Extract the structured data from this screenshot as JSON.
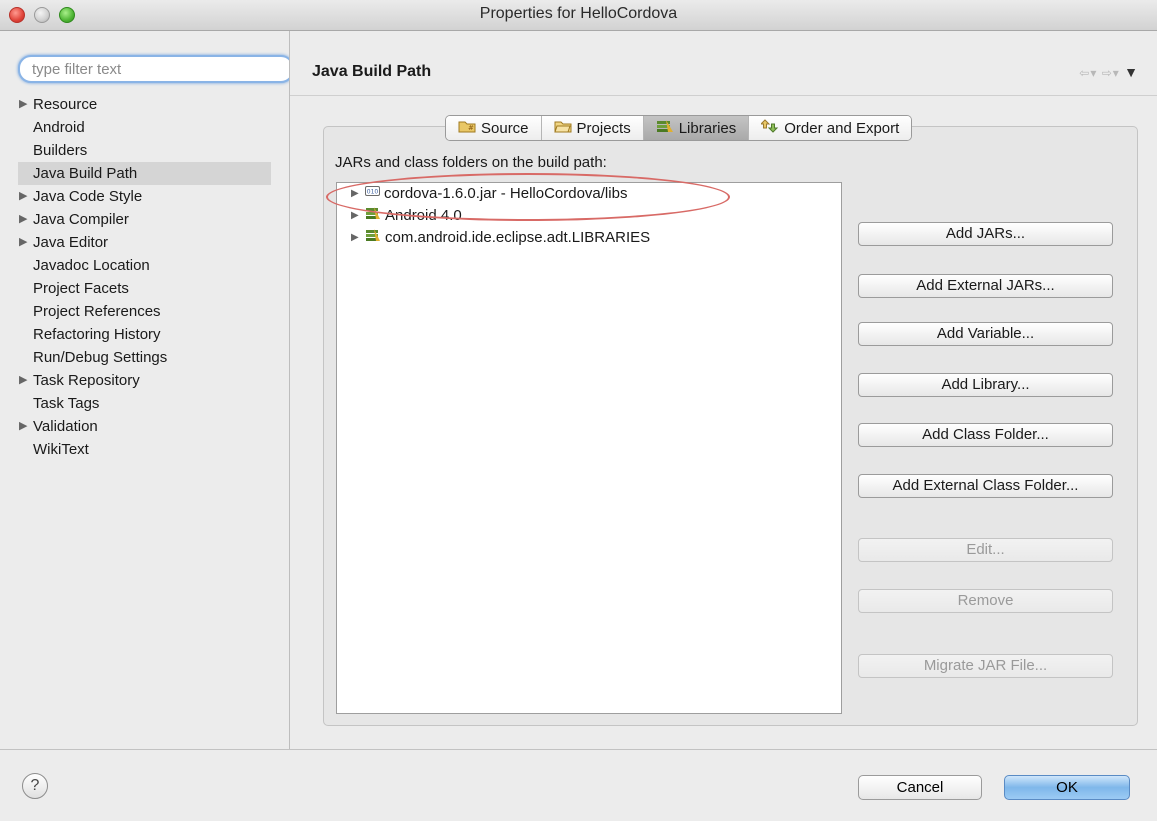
{
  "window": {
    "title": "Properties for HelloCordova"
  },
  "sidebar": {
    "filter_placeholder": "type filter text",
    "items": [
      {
        "label": "Resource",
        "expandable": true
      },
      {
        "label": "Android",
        "expandable": false
      },
      {
        "label": "Builders",
        "expandable": false
      },
      {
        "label": "Java Build Path",
        "expandable": false,
        "selected": true
      },
      {
        "label": "Java Code Style",
        "expandable": true
      },
      {
        "label": "Java Compiler",
        "expandable": true
      },
      {
        "label": "Java Editor",
        "expandable": true
      },
      {
        "label": "Javadoc Location",
        "expandable": false
      },
      {
        "label": "Project Facets",
        "expandable": false
      },
      {
        "label": "Project References",
        "expandable": false
      },
      {
        "label": "Refactoring History",
        "expandable": false
      },
      {
        "label": "Run/Debug Settings",
        "expandable": false
      },
      {
        "label": "Task Repository",
        "expandable": true
      },
      {
        "label": "Task Tags",
        "expandable": false
      },
      {
        "label": "Validation",
        "expandable": true
      },
      {
        "label": "WikiText",
        "expandable": false
      }
    ]
  },
  "main": {
    "title": "Java Build Path",
    "tabs": [
      {
        "label": "Source",
        "icon": "source-folder-icon"
      },
      {
        "label": "Projects",
        "icon": "projects-folder-icon"
      },
      {
        "label": "Libraries",
        "icon": "libraries-icon",
        "active": true
      },
      {
        "label": "Order and Export",
        "icon": "order-export-icon"
      }
    ],
    "build_path_label": "JARs and class folders on the build path:",
    "libraries": [
      {
        "label": "cordova-1.6.0.jar - HelloCordova/libs",
        "icon": "jar-icon"
      },
      {
        "label": "Android 4.0",
        "icon": "library-container-icon"
      },
      {
        "label": "com.android.ide.eclipse.adt.LIBRARIES",
        "icon": "library-container-icon"
      }
    ],
    "buttons": {
      "add_jars": "Add JARs...",
      "add_external_jars": "Add External JARs...",
      "add_variable": "Add Variable...",
      "add_library": "Add Library...",
      "add_class_folder": "Add Class Folder...",
      "add_external_class_folder": "Add External Class Folder...",
      "edit": "Edit...",
      "remove": "Remove",
      "migrate_jar": "Migrate JAR File..."
    }
  },
  "footer": {
    "help": "?",
    "cancel": "Cancel",
    "ok": "OK"
  },
  "colors": {
    "ok_button": "#7fb7ea",
    "highlight_oval": "#d86a66",
    "filter_focus": "#8ab4e6"
  }
}
